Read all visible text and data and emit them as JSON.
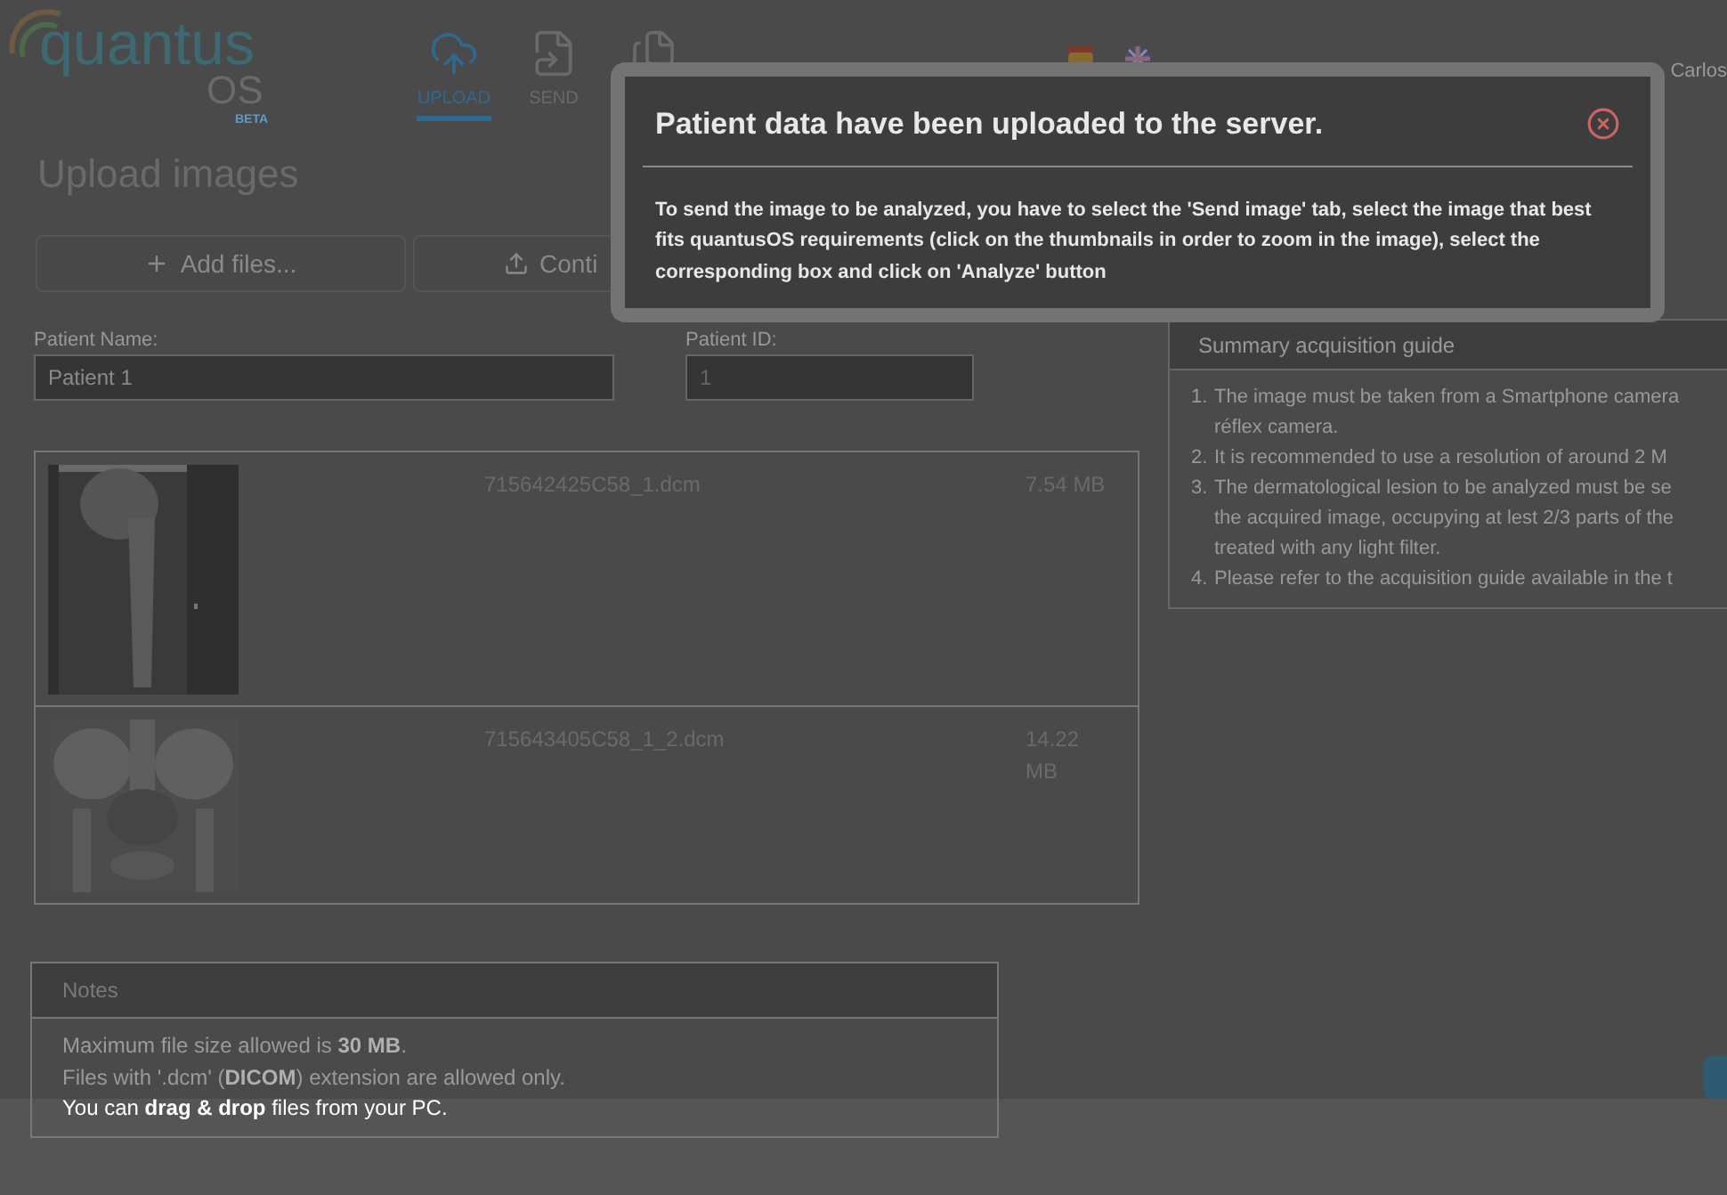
{
  "logo": {
    "name": "quantus",
    "sub": "OS",
    "badge": "BETA"
  },
  "nav": [
    {
      "kind": "upload",
      "label": "UPLOAD",
      "selected": true
    },
    {
      "kind": "send",
      "label": "SEND",
      "selected": false
    },
    {
      "kind": "report",
      "selected": false
    }
  ],
  "languages": [
    {
      "kind": "es"
    },
    {
      "kind": "en"
    }
  ],
  "user": "Carlos",
  "page_title": "Upload images",
  "buttons": [
    {
      "kind": "add",
      "label": "Add files..."
    },
    {
      "kind": "upload",
      "label": "Conti"
    }
  ],
  "fields": [
    {
      "label": "Patient Name:",
      "value": "Patient 1"
    },
    {
      "label": "Patient ID:",
      "value": "1"
    }
  ],
  "files": [
    {
      "kind": "femur",
      "name": "715642425C58_1.dcm",
      "size": "7.54 MB"
    },
    {
      "kind": "pelvis",
      "name": "715643405C58_1_2.dcm",
      "size": "14.22 MB"
    }
  ],
  "notes": {
    "title": "Notes",
    "lines": [
      {
        "text": "Maximum file size allowed is **30 MB**.",
        "dimmed": true
      },
      {
        "text": "Files with '.dcm' (**DICOM**) extension are allowed only.",
        "dimmed": true
      },
      {
        "text": "You can **drag & drop** files from your PC.",
        "dimmed": false
      }
    ]
  },
  "guide": {
    "title": "Summary acquisition guide",
    "items": [
      {
        "number": "1.",
        "lines": [
          "The image must be taken from a Smartphone camera",
          "réflex camera."
        ]
      },
      {
        "number": "2.",
        "lines": [
          "It is recommended to use a resolution of around 2 M"
        ]
      },
      {
        "number": "3.",
        "lines": [
          "The dermatological lesion to be analyzed must be se",
          "the acquired image, occupying at lest 2/3 parts of the",
          "treated with any light filter."
        ]
      },
      {
        "number": "4.",
        "lines": [
          "Please refer to the acquisition guide available in the t"
        ]
      }
    ]
  },
  "modal": {
    "title": "Patient data have been uploaded to the server.",
    "body": "To send the image to be analyzed, you have to select the 'Send image' tab, select the image that best fits quantusOS requirements (click on the thumbnails in order to zoom in the image), select the corresponding box and click on 'Analyze' button"
  }
}
